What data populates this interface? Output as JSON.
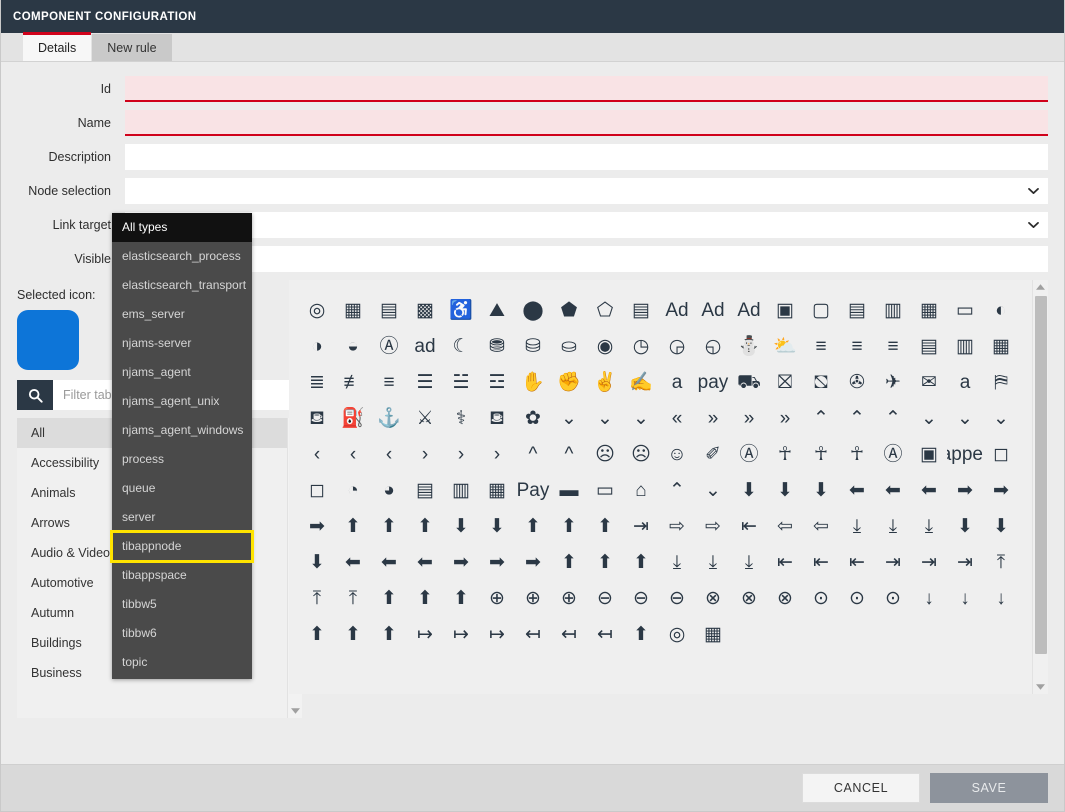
{
  "window": {
    "title": "COMPONENT CONFIGURATION"
  },
  "tabs": [
    {
      "label": "Details",
      "active": true
    },
    {
      "label": "New rule",
      "active": false
    }
  ],
  "form": {
    "fields": [
      {
        "label": "Id",
        "value": "",
        "placeholder": "",
        "type": "text",
        "error": true
      },
      {
        "label": "Name",
        "value": "",
        "placeholder": "",
        "type": "text",
        "error": true
      },
      {
        "label": "Description",
        "value": "",
        "placeholder": "",
        "type": "text",
        "error": false
      },
      {
        "label": "Node selection",
        "value": "",
        "placeholder": "",
        "type": "select",
        "error": false
      },
      {
        "label": "Link target",
        "value": "",
        "placeholder": "",
        "type": "select",
        "error": false
      },
      {
        "label": "Visible",
        "value": "",
        "placeholder": "",
        "type": "text",
        "error": false
      }
    ]
  },
  "dropdown": {
    "selected": "All types",
    "highlighted": "tibappnode",
    "items": [
      "All types",
      "elasticsearch_process",
      "elasticsearch_transport",
      "ems_server",
      "njams-server",
      "njams_agent",
      "njams_agent_unix",
      "njams_agent_windows",
      "process",
      "queue",
      "server",
      "tibappnode",
      "tibappspace",
      "tibbw5",
      "tibbw6",
      "topic"
    ]
  },
  "icon_picker": {
    "selected_icon_label": "Selected icon:",
    "selected_icon_color": "#0d75d8",
    "search": {
      "placeholder": "Filter tabs",
      "value": "",
      "icon": "search-icon"
    },
    "categories": [
      {
        "label": "All",
        "active": true
      },
      {
        "label": "Accessibility",
        "active": false
      },
      {
        "label": "Animals",
        "active": false
      },
      {
        "label": "Arrows",
        "active": false
      },
      {
        "label": "Audio & Video",
        "active": false
      },
      {
        "label": "Automotive",
        "active": false
      },
      {
        "label": "Autumn",
        "active": false
      },
      {
        "label": "Buildings",
        "active": false
      },
      {
        "label": "Business",
        "active": false
      }
    ],
    "grid_icons": [
      "spiral-icon",
      "abacus-solid-icon",
      "abacus-line-icon",
      "abacus-thin-icon",
      "accessible-icon",
      "acquisitions-icon",
      "acorn-solid-icon",
      "acorn-line-icon",
      "acorn-thin-icon",
      "address-book-solid-icon",
      "ad-solid-icon",
      "ad-line-icon",
      "ad-thin-icon",
      "address-card-solid-icon",
      "address-card-line-icon",
      "address-book-line-icon",
      "id-card-solid-icon",
      "id-card-line-icon",
      "address-card-outline-icon",
      "adjust-solid-icon",
      "adjust-line-icon",
      "adjust-thin-icon",
      "adversal-icon",
      "ad-box-icon",
      "affiliatetheme-icon",
      "air-freshener-solid-icon",
      "air-freshener-line-icon",
      "air-freshener-thin-icon",
      "alarm-icon",
      "alarm-clock-solid-icon",
      "alarm-clock-line-icon",
      "alarm-clock-thin-icon",
      "alicorn-solid-icon",
      "alicorn-line-icon",
      "align-center-solid-icon",
      "align-center-line-icon",
      "align-center-thin-icon",
      "align-justify-solid-icon",
      "align-justify-line-icon",
      "align-justify-thin-icon",
      "align-left-solid-icon",
      "align-left-line-icon",
      "align-left-thin-icon",
      "align-right-solid-icon",
      "align-right-line-icon",
      "align-right-thin-icon",
      "allergies-icon",
      "hand-paper-solid-icon",
      "hand-paper-line-icon",
      "hand-paper-thin-icon",
      "amazon-icon",
      "amazon-pay-icon",
      "ambulance-solid-icon",
      "ambulance-line-icon",
      "ambulance-thin-icon",
      "american-sign-language-solid-icon",
      "american-sign-language-line-icon",
      "american-sign-language-thin-icon",
      "amazon-a-icon",
      "analytics-solid-icon",
      "analytics-line-icon",
      "analytics-thin-icon",
      "anchor-solid-icon",
      "anchor-line-icon",
      "anchor-thin-icon",
      "android-icon",
      "angellist-icon",
      "angle-double-down-solid-icon",
      "angle-double-down-line-icon",
      "angle-double-down-thin-icon",
      "angle-double-left-solid-icon",
      "angle-double-right-solid-icon",
      "angle-double-right-line-icon",
      "angle-double-right-thin-icon",
      "angle-up-double-solid-icon",
      "angle-up-double-line-icon",
      "angle-up-double-thin-icon",
      "angle-down-solid-icon",
      "angle-down-line-icon",
      "angle-down-thin-icon",
      "angle-left-solid-icon",
      "angle-left-line-icon",
      "angle-left-thin-icon",
      "angle-right-solid-icon",
      "angle-right-line-icon",
      "angle-right-thin-icon",
      "angle-up-solid-icon",
      "angle-up-line-icon",
      "angry-solid-icon",
      "angry-line-icon",
      "angry-thin-icon",
      "angrycreative-icon",
      "angular-icon",
      "ankh-solid-icon",
      "ankh-line-icon",
      "ankh-thin-icon",
      "app-store-icon",
      "app-store-ios-icon",
      "apper-icon",
      "apple-solid-icon",
      "apple-line-icon",
      "apple-alt-solid-icon",
      "apple-alt-line-icon",
      "apple-crate-solid-icon",
      "apple-crate-line-icon",
      "apple-crate-thin-icon",
      "apple-pay-icon",
      "archive-solid-icon",
      "archive-line-icon",
      "archive-thin-icon",
      "archway-solid-icon",
      "archway-line-icon",
      "archway-thin-icon",
      "arrow-alt-circle-down-solid-icon",
      "arrow-alt-circle-down-line-icon",
      "arrow-alt-circle-down-thin-icon",
      "arrow-alt-circle-left-solid-icon",
      "arrow-alt-circle-left-line-icon",
      "arrow-alt-circle-left-thin-icon",
      "arrow-alt-circle-right-solid-icon",
      "arrow-alt-circle-right-line-icon",
      "arrow-alt-circle-right-thin-icon",
      "arrow-alt-circle-up-solid-icon",
      "arrow-alt-circle-up-line-icon",
      "arrow-alt-circle-up-thin-icon",
      "arrow-alt-down-solid-icon",
      "arrow-alt-down-line-icon",
      "arrow-alt-down-thin-icon",
      "arrow-alt-from-bottom-solid-icon",
      "arrow-alt-from-bottom-line-icon",
      "arrow-alt-from-bottom-thin-icon",
      "arrow-alt-from-left-solid-icon",
      "arrow-alt-from-left-line-icon",
      "arrow-alt-from-left-thin-icon",
      "arrow-alt-from-right-solid-icon",
      "arrow-alt-from-right-line-icon",
      "arrow-alt-from-right-thin-icon",
      "arrow-alt-from-top-solid-icon",
      "arrow-alt-from-top-line-icon",
      "arrow-alt-from-top-thin-icon",
      "arrow-alt-square-down-solid-icon",
      "arrow-alt-square-down-line-icon",
      "arrow-alt-square-down-thin-icon",
      "arrow-alt-square-left-solid-icon",
      "arrow-alt-square-left-line-icon",
      "arrow-alt-square-left-thin-icon",
      "arrow-alt-square-right-solid-icon",
      "arrow-alt-square-right-line-icon",
      "arrow-alt-square-right-thin-icon",
      "arrow-alt-square-up-solid-icon",
      "arrow-alt-square-up-line-icon",
      "arrow-alt-square-up-thin-icon",
      "arrow-alt-to-bottom-solid-icon",
      "arrow-alt-to-bottom-line-icon",
      "arrow-alt-to-bottom-thin-icon",
      "arrow-alt-to-left-solid-icon",
      "arrow-alt-to-left-line-icon",
      "arrow-alt-to-left-thin-icon",
      "arrow-alt-to-right-solid-icon",
      "arrow-alt-to-right-line-icon",
      "arrow-alt-to-right-thin-icon",
      "arrow-alt-to-top-solid-icon",
      "arrow-alt-to-top-line-icon",
      "arrow-alt-to-top-thin-icon",
      "arrow-alt-up-solid-icon",
      "arrow-alt-up-line-icon",
      "arrow-alt-up-thin-icon",
      "arrow-circle-down-solid-icon",
      "arrow-circle-down-line-icon",
      "arrow-circle-down-thin-icon",
      "arrow-circle-left-solid-icon",
      "arrow-circle-left-line-icon",
      "arrow-circle-left-thin-icon",
      "arrow-circle-right-solid-icon",
      "arrow-circle-right-line-icon",
      "arrow-circle-right-thin-icon",
      "arrow-circle-up-solid-icon",
      "arrow-circle-up-line-icon",
      "arrow-circle-up-thin-icon",
      "arrow-down-solid-icon",
      "arrow-down-line-icon",
      "arrow-down-thin-icon",
      "arrow-from-bottom-solid-icon",
      "arrow-from-bottom-line-icon",
      "arrow-from-bottom-thin-icon",
      "arrow-from-left-solid-icon",
      "arrow-from-left-line-icon",
      "arrow-from-left-thin-icon",
      "arrow-from-right-solid-icon",
      "arrow-from-right-line-icon",
      "arrow-from-right-thin-icon",
      "arrow-from-top-solid-icon"
    ]
  },
  "footer": {
    "cancel_label": "CANCEL",
    "save_label": "SAVE",
    "save_enabled": false
  }
}
